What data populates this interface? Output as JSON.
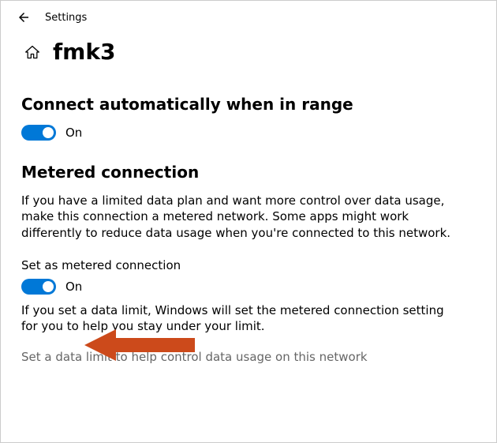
{
  "header": {
    "app_title": "Settings"
  },
  "page": {
    "network_name": "fmk3"
  },
  "auto_connect": {
    "heading": "Connect automatically when in range",
    "toggle_state": "On"
  },
  "metered": {
    "heading": "Metered connection",
    "description": "If you have a limited data plan and want more control over data usage, make this connection a metered network. Some apps might work differently to reduce data usage when you're connected to this network.",
    "toggle_label": "Set as metered connection",
    "toggle_state": "On",
    "data_limit_note": "If you set a data limit, Windows will set the metered connection setting for you to help you stay under your limit.",
    "data_limit_link": "Set a data limit to help control data usage on this network"
  },
  "colors": {
    "accent": "#0078D7",
    "annotation": "#CC4A1B"
  }
}
